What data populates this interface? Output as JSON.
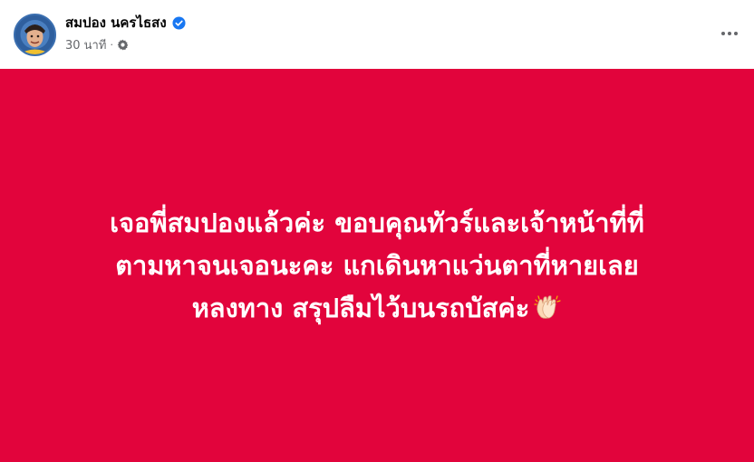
{
  "author": {
    "name": "สมปอง นครไธสง",
    "verified": true
  },
  "post_meta": {
    "time": "30 นาที",
    "separator": "·",
    "audience_icon": "gear-icon"
  },
  "more_icon": "more-horizontal-icon",
  "status": {
    "background_color": "#e2043c",
    "text_color": "#ffffff",
    "lines": [
      "เจอพี่สมปองแล้วค่ะ ขอบคุณทัวร์และเจ้าหน้าที่ที่",
      "ตามหาจนเจอนะคะ แกเดินหาแว่นตาที่หายเลย",
      "หลงทาง สรุปลืมไว้บนรถบัสค่ะ"
    ],
    "emoji": "clapping-hands"
  }
}
